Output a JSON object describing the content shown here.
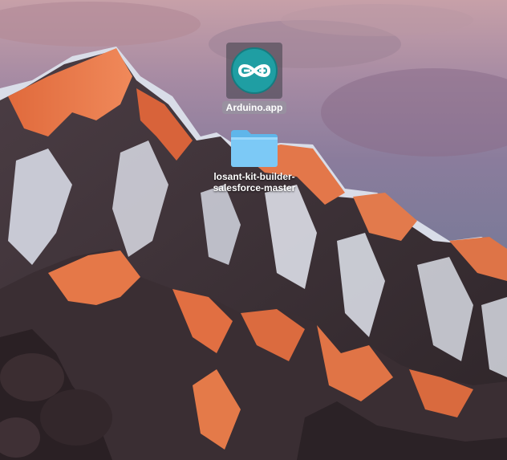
{
  "desktop": {
    "wallpaper": "mountain-sunset-wallpaper",
    "icons": [
      {
        "label": "Arduino.app",
        "icon": "arduino-app-icon",
        "selected": true,
        "color": "#1f9ea3"
      },
      {
        "label": "losant-kit-builder-salesforce-master",
        "icon": "folder-icon",
        "selected": false,
        "color": "#79c8f5"
      }
    ]
  }
}
